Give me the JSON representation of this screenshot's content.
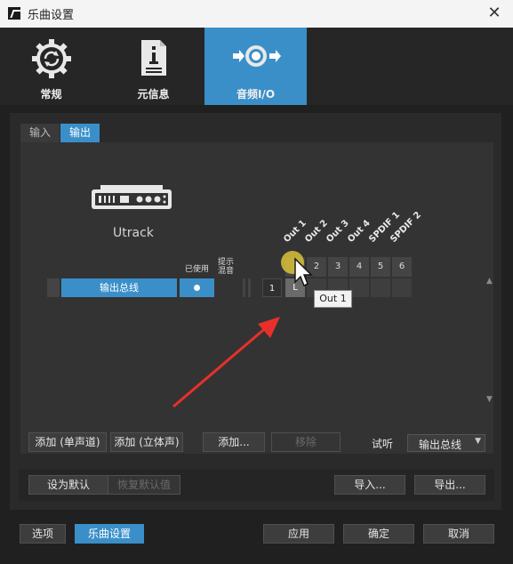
{
  "window": {
    "title": "乐曲设置",
    "close_label": "✕"
  },
  "categories": [
    {
      "label": "常规"
    },
    {
      "label": "元信息"
    },
    {
      "label": "音频I/O"
    }
  ],
  "subtabs": {
    "input": "输入",
    "output": "输出"
  },
  "device": {
    "name": "Utrack"
  },
  "columns": {
    "used": "已使用",
    "mix": "提示\n混音"
  },
  "outputs": [
    {
      "label": "Out 1",
      "num": "1"
    },
    {
      "label": "Out 2",
      "num": "2"
    },
    {
      "label": "Out 3",
      "num": "3"
    },
    {
      "label": "Out 4",
      "num": "4"
    },
    {
      "label": "SPDIF 1",
      "num": "5"
    },
    {
      "label": "SPDIF 2",
      "num": "6"
    }
  ],
  "bus": {
    "name": "输出总线",
    "cell_1": "1",
    "cell_L": "L"
  },
  "tooltip": "Out 1",
  "buttons": {
    "add_mono": "添加 (单声道)",
    "add_stereo": "添加 (立体声)",
    "add": "添加...",
    "remove": "移除",
    "set_default": "设为默认",
    "reset_default": "恢复默认值",
    "import": "导入...",
    "export": "导出...",
    "options": "选项",
    "song_settings": "乐曲设置",
    "apply": "应用",
    "ok": "确定",
    "cancel": "取消"
  },
  "audition": {
    "label": "试听",
    "value": "输出总线"
  },
  "colors": {
    "accent": "#3a8fc9",
    "background": "#202020"
  }
}
